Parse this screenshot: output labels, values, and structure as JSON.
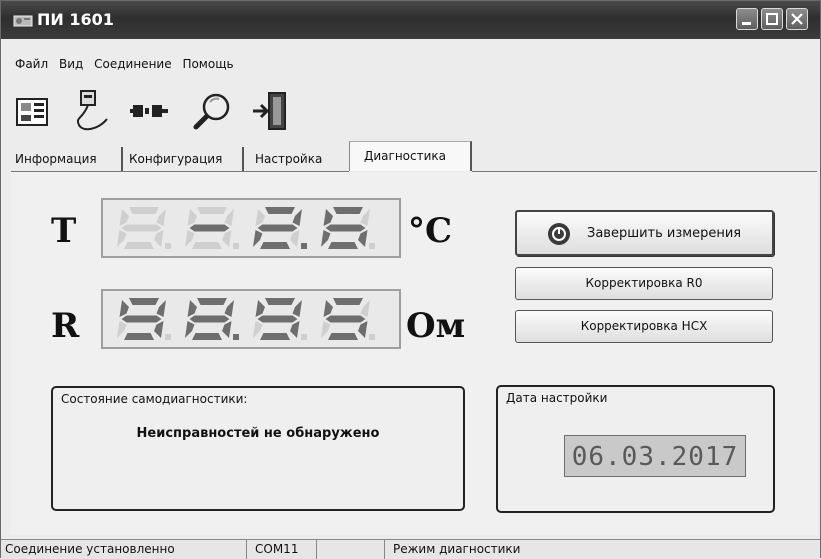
{
  "window": {
    "title": "ПИ 1601"
  },
  "menu": [
    "Файл",
    "Вид",
    "Соединение",
    "Помощь"
  ],
  "toolbar": [
    {
      "icon": "device-panel-icon"
    },
    {
      "icon": "cable-icon"
    },
    {
      "icon": "plug-connect-icon"
    },
    {
      "icon": "magnifier-icon"
    },
    {
      "icon": "exit-door-icon"
    }
  ],
  "tabs": [
    "Информация",
    "Конфигурация",
    "Настройка",
    "Диагностика"
  ],
  "active_tab": "Диагностика",
  "readings": {
    "temperature": {
      "letter": "T",
      "value": "-2.6",
      "unit": "°C"
    },
    "resistance": {
      "letter": "R",
      "value": "98.95",
      "unit": "Ом"
    }
  },
  "buttons": {
    "stop": "Завершить измерения",
    "correct_r0": "Корректировка R0",
    "correct_hsx": "Корректировка НСХ"
  },
  "self_diagnostics": {
    "caption": "Состояние самодиагностики:",
    "status": "Неисправностей не обнаружено"
  },
  "calibration": {
    "caption": "Дата настройки",
    "date": "06.03.2017"
  },
  "statusbar": {
    "connection": "Соединение установленно",
    "port": "COM11",
    "empty": "",
    "mode": "Режим диагностики"
  },
  "colors": {
    "title_bar": "#3a3a3a",
    "segment_on": "#6e6e6e",
    "segment_off": "#cfcfcf"
  }
}
